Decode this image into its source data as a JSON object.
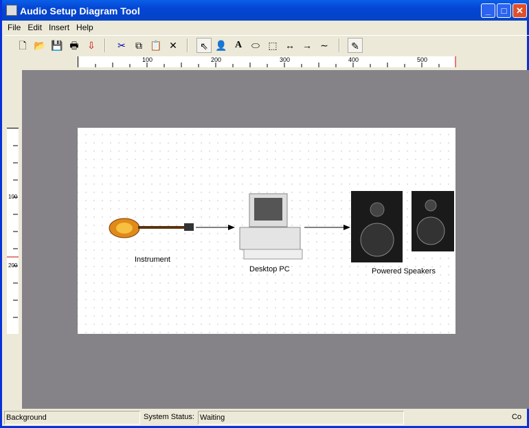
{
  "window": {
    "title": "Audio Setup Diagram Tool"
  },
  "menu": [
    "File",
    "Edit",
    "Insert",
    "Help"
  ],
  "toolbar": {
    "icons": [
      "new-icon",
      "open-icon",
      "save-icon",
      "print-icon",
      "export-icon",
      "cut-icon",
      "copy-icon",
      "paste-icon",
      "delete-icon",
      "pointer-icon",
      "person-icon",
      "text-icon",
      "ellipse-icon",
      "rectangle-icon",
      "double-arrow-icon",
      "arrow-icon",
      "curve-icon",
      "pencil-icon"
    ],
    "selected": "pointer-icon"
  },
  "rulers": {
    "horizontal": [
      "100",
      "200",
      "300",
      "400",
      "500"
    ],
    "vertical": [
      "100",
      "200"
    ]
  },
  "diagram": {
    "nodes": [
      {
        "label": "Instrument",
        "icon": "bass-guitar"
      },
      {
        "label": "Desktop PC",
        "icon": "desktop-computer"
      },
      {
        "label": "Powered Speakers",
        "icon": "speakers"
      }
    ]
  },
  "status": {
    "left": "Background",
    "status_label": "System Status:",
    "status_value": "Waiting",
    "right": "Co"
  }
}
